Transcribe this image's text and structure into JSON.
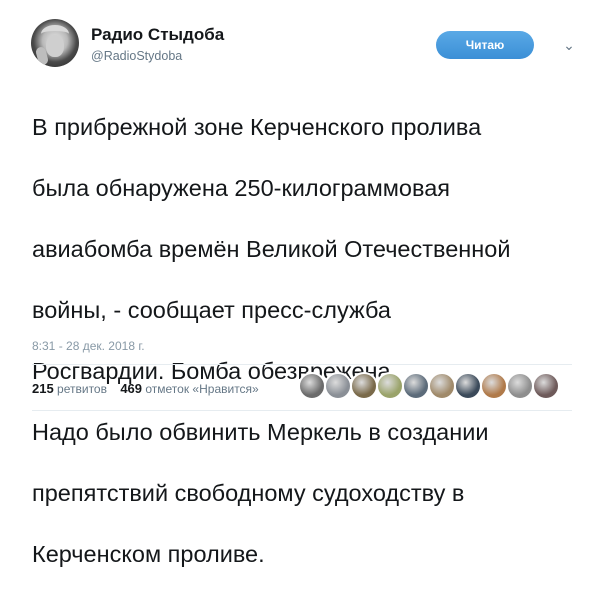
{
  "account": {
    "display_name": "Радио Стыдоба",
    "handle": "@RadioStydoba"
  },
  "follow_button": {
    "label": "Читаю"
  },
  "tweet": {
    "lines": [
      "В прибрежной зоне Керченского пролива",
      "была обнаружена 250-килограммовая",
      "авиабомба времён Великой Отечественной",
      "войны, - сообщает пресс-служба",
      "Росгвардии. Бомба обезврежена.",
      "Надо было обвинить Меркель в создании",
      "препятствий свободному судоходству в",
      "Керченском проливе."
    ],
    "timestamp": "8:31 - 28 дек. 2018 г."
  },
  "stats": {
    "retweets_count": "215",
    "retweets_label": "ретвитов",
    "likes_count": "469",
    "likes_label": "отметок «Нравится»"
  },
  "liker_avatar_colors": [
    "#6b6b6b",
    "#8a8f96",
    "#7a6a4a",
    "#9aa36a",
    "#5c6b7a",
    "#a08a6a",
    "#3b4a5a",
    "#b07a4a",
    "#8e8e8e",
    "#6e5a5a"
  ],
  "icons": [
    "chevron-down-icon"
  ]
}
